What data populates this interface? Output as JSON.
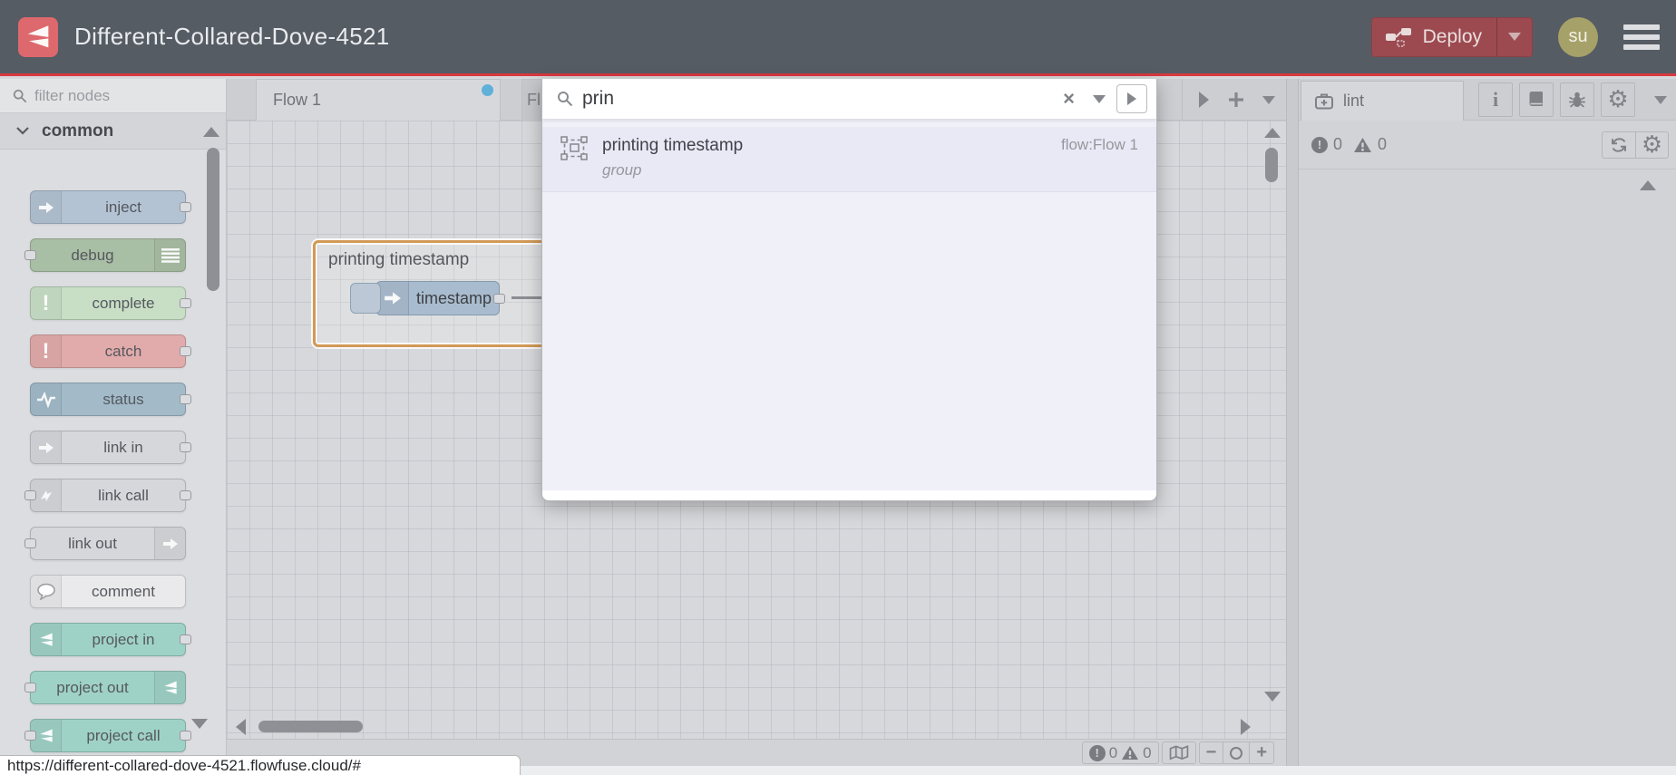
{
  "header": {
    "title": "Different-Collared-Dove-4521",
    "deploy": {
      "label": "Deploy"
    },
    "avatar": {
      "initials": "su"
    }
  },
  "palette": {
    "filter_placeholder": "filter nodes",
    "category_label": "common",
    "nodes": [
      {
        "label": "inject",
        "color": "#b3c3d3",
        "icon": "inject-arrow-icon"
      },
      {
        "label": "debug",
        "color": "#a9bfa5",
        "icon": "debug-list-icon"
      },
      {
        "label": "complete",
        "color": "#c8dfc6",
        "icon": "exclamation-icon"
      },
      {
        "label": "catch",
        "color": "#e2abab",
        "icon": "exclamation-icon"
      },
      {
        "label": "status",
        "color": "#a3bac9",
        "icon": "status-pulse-icon"
      },
      {
        "label": "link in",
        "color": "#d6d7da",
        "icon": "link-arrow-icon"
      },
      {
        "label": "link call",
        "color": "#d6d7da",
        "icon": "link-arrow-icon"
      },
      {
        "label": "link out",
        "color": "#d6d7da",
        "icon": "link-arrow-icon"
      },
      {
        "label": "comment",
        "color": "#eaeaec",
        "icon": "comment-bubble-icon"
      },
      {
        "label": "project in",
        "color": "#9fd2c6",
        "icon": "flowfuse-logo-icon"
      },
      {
        "label": "project out",
        "color": "#9fd2c6",
        "icon": "flowfuse-logo-icon"
      },
      {
        "label": "project call",
        "color": "#9fd2c6",
        "icon": "flowfuse-logo-icon"
      }
    ]
  },
  "workspace": {
    "tabs": [
      {
        "label": "Flow 1",
        "modified": true
      },
      {
        "label": "Fl"
      }
    ],
    "group": {
      "label": "printing timestamp",
      "node_label": "timestamp"
    }
  },
  "search": {
    "query": "prin",
    "result": {
      "title": "printing timestamp",
      "subtitle": "group",
      "location": "flow:Flow 1"
    }
  },
  "sidebar": {
    "tab_label": "lint",
    "errors": "0",
    "warnings": "0"
  },
  "canvas_footer": {
    "errors": "0",
    "warnings": "0",
    "zoom_out_label": "−",
    "zoom_in_label": "+"
  },
  "statusbar": {
    "url": "https://different-collared-dove-4521.flowfuse.cloud/#"
  },
  "colors": {
    "header_bg": "#565c64",
    "accent_red": "#d8393f",
    "deploy_bg": "#9c4a50",
    "group_selected_border": "#d29a57",
    "modified_dot": "#5fb1da"
  }
}
